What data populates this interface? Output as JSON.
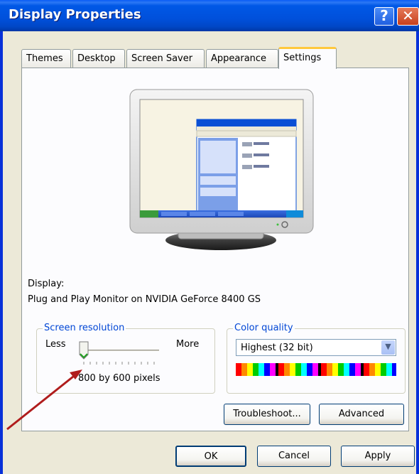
{
  "window": {
    "title": "Display Properties",
    "help_label": "?",
    "close_label": "✕"
  },
  "tabs": [
    {
      "label": "Themes"
    },
    {
      "label": "Desktop"
    },
    {
      "label": "Screen Saver"
    },
    {
      "label": "Appearance"
    },
    {
      "label": "Settings",
      "active": true
    }
  ],
  "display": {
    "heading": "Display:",
    "device": "Plug and Play Monitor on NVIDIA GeForce 8400 GS"
  },
  "resolution": {
    "legend": "Screen resolution",
    "less_label": "Less",
    "more_label": "More",
    "value_text": "800 by 600 pixels",
    "slider_position": 0
  },
  "color_quality": {
    "legend": "Color quality",
    "selected": "Highest (32 bit)"
  },
  "buttons": {
    "troubleshoot": "Troubleshoot...",
    "advanced": "Advanced",
    "ok": "OK",
    "cancel": "Cancel",
    "apply": "Apply"
  },
  "colors": {
    "titlebar": "#0054e3",
    "annotation_arrow": "#b01c1c",
    "legend_text": "#0046d5"
  }
}
